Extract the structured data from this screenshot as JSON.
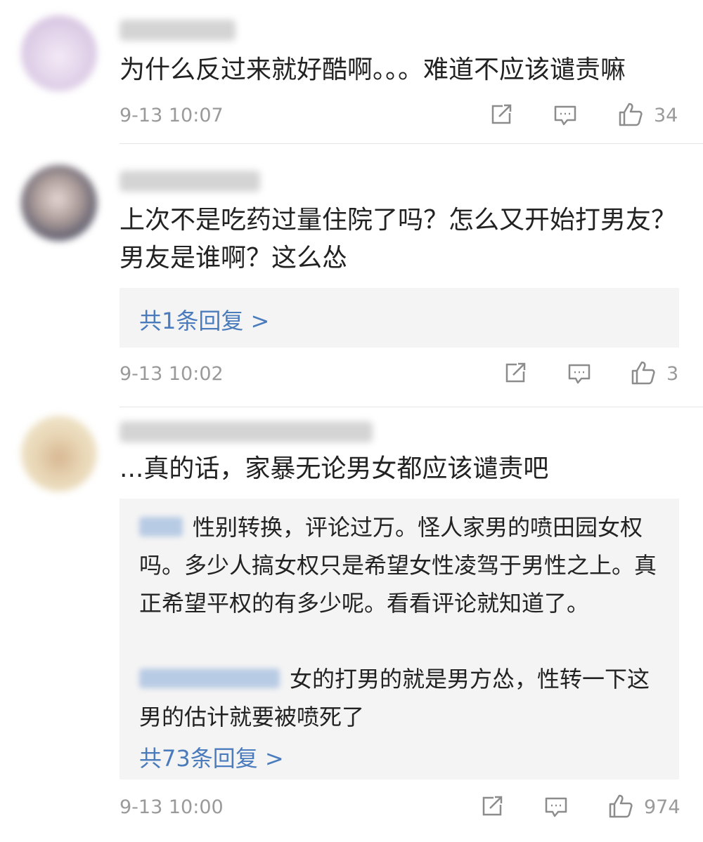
{
  "comments": [
    {
      "text": "为什么反过来就好酷啊。。。难道不应该谴责嘛",
      "timestamp": "9-13 10:07",
      "likes": "34",
      "icons": {
        "share": "share-icon",
        "comment": "comment-icon",
        "like": "thumbs-up-icon"
      }
    },
    {
      "text": "上次不是吃药过量住院了吗？怎么又开始打男友？\n男友是谁啊？这么怂",
      "reply_link": "共1条回复 >",
      "timestamp": "9-13 10:02",
      "likes": "3"
    },
    {
      "text": "...真的话，家暴无论男女都应该谴责吧",
      "replies": [
        {
          "text": "性别转换，评论过万。怪人家男的喷田园女权吗。多少人搞女权只是希望女性凌驾于男性之上。真正希望平权的有多少呢。看看评论就知道了。"
        },
        {
          "text": "女的打男的就是男方怂，性转一下这男的估计就要被喷死了"
        }
      ],
      "reply_link": "共73条回复 >",
      "timestamp": "9-13 10:00",
      "likes": "974"
    }
  ],
  "colors": {
    "link": "#4a7bbd",
    "meta_text": "#9a9a9a",
    "reply_bg": "#f4f4f4"
  }
}
